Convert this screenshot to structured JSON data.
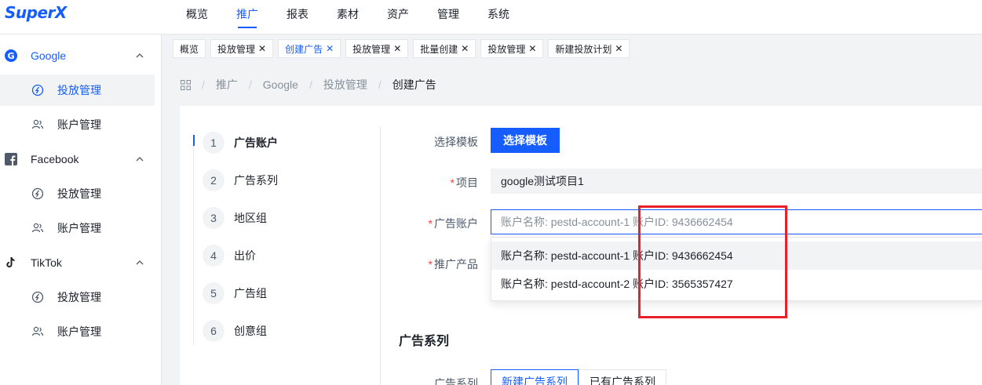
{
  "app": {
    "logo": "SuperX"
  },
  "top_nav": {
    "items": [
      {
        "label": "概览",
        "active": false
      },
      {
        "label": "推广",
        "active": true
      },
      {
        "label": "报表",
        "active": false
      },
      {
        "label": "素材",
        "active": false
      },
      {
        "label": "资产",
        "active": false
      },
      {
        "label": "管理",
        "active": false
      },
      {
        "label": "系统",
        "active": false
      }
    ]
  },
  "sidebar": {
    "groups": [
      {
        "label": "Google",
        "icon": "google-icon",
        "items": [
          {
            "label": "投放管理",
            "icon": "delivery-icon",
            "active": true
          },
          {
            "label": "账户管理",
            "icon": "users-icon",
            "active": false
          }
        ]
      },
      {
        "label": "Facebook",
        "icon": "facebook-icon",
        "items": [
          {
            "label": "投放管理",
            "icon": "delivery-icon",
            "active": false
          },
          {
            "label": "账户管理",
            "icon": "users-icon",
            "active": false
          }
        ]
      },
      {
        "label": "TikTok",
        "icon": "tiktok-icon",
        "items": [
          {
            "label": "投放管理",
            "icon": "delivery-icon",
            "active": false
          },
          {
            "label": "账户管理",
            "icon": "users-icon",
            "active": false
          }
        ]
      }
    ]
  },
  "tabs": {
    "items": [
      {
        "label": "概览",
        "closable": false,
        "active": false
      },
      {
        "label": "投放管理",
        "closable": true,
        "active": false
      },
      {
        "label": "创建广告",
        "closable": true,
        "active": true
      },
      {
        "label": "投放管理",
        "closable": true,
        "active": false
      },
      {
        "label": "批量创建",
        "closable": true,
        "active": false
      },
      {
        "label": "投放管理",
        "closable": true,
        "active": false
      },
      {
        "label": "新建投放计划",
        "closable": true,
        "active": false
      }
    ],
    "close_glyph": "✕"
  },
  "breadcrumb": {
    "items": [
      "推广",
      "Google",
      "投放管理",
      "创建广告"
    ],
    "separator": "/"
  },
  "steps": {
    "items": [
      {
        "num": "1",
        "label": "广告账户"
      },
      {
        "num": "2",
        "label": "广告系列"
      },
      {
        "num": "3",
        "label": "地区组"
      },
      {
        "num": "4",
        "label": "出价"
      },
      {
        "num": "5",
        "label": "广告组"
      },
      {
        "num": "6",
        "label": "创意组"
      }
    ]
  },
  "form": {
    "template_label": "选择模板",
    "template_button": "选择模板",
    "required_mark": "*",
    "project_label": "项目",
    "project_value": "google测试项目1",
    "account_label": "广告账户",
    "account_value": "账户名称: pestd-account-1 账户ID: 9436662454",
    "product_label": "推广产品",
    "account_options": [
      "账户名称: pestd-account-1 账户ID: 9436662454",
      "账户名称: pestd-account-2 账户ID: 3565357427"
    ]
  },
  "campaign_section": {
    "title": "广告系列",
    "field_label": "广告系列",
    "options": [
      "新建广告系列",
      "已有广告系列"
    ]
  },
  "colors": {
    "primary": "#165dff",
    "highlight": "#e8202a",
    "required": "#f53f3f"
  }
}
